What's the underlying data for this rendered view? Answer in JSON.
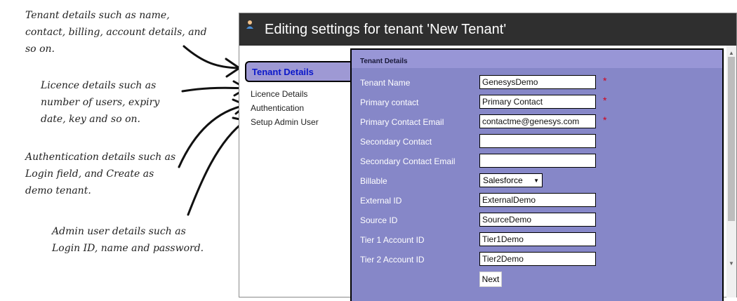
{
  "annotations": {
    "tenant": "Tenant details such as name, contact, billing, account details, and so on.",
    "licence": "Licence details such as number of users, expiry date, key and so on.",
    "auth": "Authentication details such as Login field, and Create as demo tenant.",
    "admin": "Admin user details such as Login ID, name and password."
  },
  "window": {
    "title": "Editing settings for tenant 'New Tenant'"
  },
  "nav": {
    "active": "Tenant Details",
    "items": [
      "Licence Details",
      "Authentication",
      "Setup Admin User"
    ]
  },
  "form": {
    "section_title": "Tenant Details",
    "fields": [
      {
        "label": "Tenant Name",
        "value": "GenesysDemo",
        "required": true
      },
      {
        "label": "Primary contact",
        "value": "Primary Contact",
        "required": true
      },
      {
        "label": "Primary Contact Email",
        "value": "contactme@genesys.com",
        "required": true
      },
      {
        "label": "Secondary Contact",
        "value": "",
        "required": false
      },
      {
        "label": "Secondary Contact Email",
        "value": "",
        "required": false
      },
      {
        "label": "Billable",
        "value": "Salesforce",
        "type": "select"
      },
      {
        "label": "External ID",
        "value": "ExternalDemo"
      },
      {
        "label": "Source ID",
        "value": "SourceDemo"
      },
      {
        "label": "Tier 1 Account ID",
        "value": "Tier1Demo"
      },
      {
        "label": "Tier 2 Account ID",
        "value": "Tier2Demo"
      }
    ],
    "required_mark": "*",
    "next_label": "Next"
  },
  "colors": {
    "panel": "#8687c8",
    "panel_header": "#9896d6",
    "active_tab_text": "#0b18c9",
    "required": "#d0021b"
  }
}
